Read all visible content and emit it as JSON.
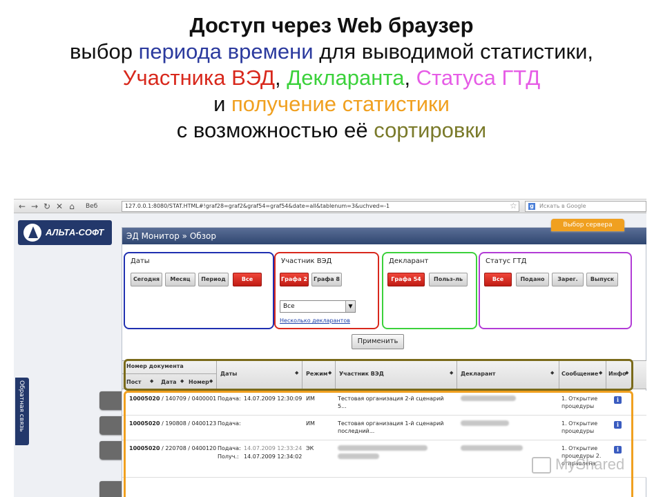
{
  "slide": {
    "line1": "Доступ через Web браузер",
    "line2_a": "выбор ",
    "line2_b": "периода времени",
    "line2_c": " для выводимой статистики,",
    "line3_a": "Участника ВЭД",
    "line3_b": ", ",
    "line3_c": "Декларанта",
    "line3_d": ", ",
    "line3_e": "Статуса ГТД",
    "line4_a": "и ",
    "line4_b": "получение статистики",
    "line5_a": "с возможностью её ",
    "line5_b": "сортировки"
  },
  "browser": {
    "web_label": "Веб",
    "url": "127.0.0.1:8080/STAT.HTML#!graf28=graf2&graf54=graf54&date=all&tablenum=3&uchved=-1",
    "search_placeholder": "Искать в Google",
    "google_letter": "g"
  },
  "logo": {
    "text": "АЛЬТА-СОФТ"
  },
  "feedback": {
    "label": "Обратная связь"
  },
  "server_tab": "Выбор сервера",
  "panel": {
    "title": "ЭД Монитор » Обзор"
  },
  "filters": {
    "dates": {
      "title": "Даты",
      "buttons": [
        "Сегодня",
        "Месяц",
        "Период",
        "Все"
      ]
    },
    "participant": {
      "title": "Участник ВЭД",
      "buttons": [
        "Графа 2",
        "Графа 8"
      ],
      "select_value": "Все",
      "link": "Несколько декларантов"
    },
    "declarant": {
      "title": "Декларант",
      "buttons": [
        "Графа 54",
        "Польз-ль"
      ]
    },
    "status": {
      "title": "Статус ГТД",
      "buttons": [
        "Все",
        "Подано",
        "Зарег.",
        "Выпуск"
      ]
    }
  },
  "apply_label": "Применить",
  "table": {
    "headers": {
      "doc": "Номер документа",
      "post": "Пост",
      "date": "Дата",
      "number": "Номер",
      "dates": "Даты",
      "mode": "Режим",
      "participant": "Участник ВЭД",
      "declarant": "Декларант",
      "message": "Сообщение",
      "info": "Инфо"
    },
    "rows": [
      {
        "post": "10005020",
        "docnum": "/ 140709 / 0400001",
        "label1": "Подача:",
        "date1": "14.07.2009 12:30:09",
        "label2": "",
        "date2": "",
        "mode": "ИМ",
        "participant": "Тестовая организация 2-й сценарий 5...",
        "message": "1. Открытие процедуры"
      },
      {
        "post": "10005020",
        "docnum": "/ 190808 / 0400123",
        "label1": "Подача:",
        "date1": "",
        "label2": "",
        "date2": "",
        "mode": "ИМ",
        "participant": "Тестовая организация 1-й сценарий последний...",
        "message": "1. Открытие процедуры"
      },
      {
        "post": "10005020",
        "docnum": "/ 220708 / 0400120",
        "label1": "Подача:",
        "date1": "14.07.2009 12:33:24",
        "label2": "Получ.:",
        "date2": "14.07.2009 12:34:02",
        "mode": "ЭК",
        "participant": "",
        "message": "1. Открытие процедуры 2. отправлена"
      }
    ]
  },
  "watermark": "MyShared",
  "colors": {
    "dates_box": "#1f2fb0",
    "participant_box": "#d8281c",
    "declarant_box": "#3bd13b",
    "status_box": "#b23bd6",
    "header_box": "#7a6a1a",
    "rows_box": "#f0a020"
  }
}
